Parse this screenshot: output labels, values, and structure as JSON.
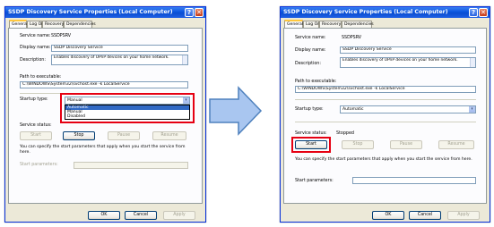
{
  "left": {
    "title": "SSDP Discovery Service Properties (Local Computer)",
    "help": "?",
    "close": "✕",
    "tabs": [
      "General",
      "Log On",
      "Recovery",
      "Dependencies"
    ],
    "service_name_label": "Service name:",
    "service_name_value": "SSDPSRV",
    "display_name_label": "Display name:",
    "display_name_value": "SSDP Discovery Service",
    "description_label": "Description:",
    "description_value": "Enables discovery of UPnP devices on your home network.",
    "path_label": "Path to executable:",
    "path_value": "C:\\WINDOWS\\System32\\svchost.exe -k LocalService",
    "startup_type_label": "Startup type:",
    "startup_type_value": "Manual",
    "startup_options": [
      "Automatic",
      "Manual",
      "Disabled"
    ],
    "startup_selected_index": 0,
    "service_status_label": "Service status:",
    "service_status_value": "",
    "buttons": {
      "start": "Start",
      "stop": "Stop",
      "pause": "Pause",
      "resume": "Resume"
    },
    "note": "You can specify the start parameters that apply when you start the service from here.",
    "start_params_label": "Start parameters:",
    "ok": "OK",
    "cancel": "Cancel",
    "apply": "Apply"
  },
  "right": {
    "title": "SSDP Discovery Service Properties (Local Computer)",
    "help": "?",
    "close": "✕",
    "tabs": [
      "General",
      "Log On",
      "Recovery",
      "Dependencies"
    ],
    "service_name_label": "Service name:",
    "service_name_value": "SSDPSRV",
    "display_name_label": "Display name:",
    "display_name_value": "SSDP Discovery Service",
    "description_label": "Description:",
    "description_value": "Enables discovery of UPnP devices on your home network.",
    "path_label": "Path to executable:",
    "path_value": "C:\\WINDOWS\\System32\\svchost.exe -k LocalService",
    "startup_type_label": "Startup type:",
    "startup_type_value": "Automatic",
    "service_status_label": "Service status:",
    "service_status_value": "Stopped",
    "buttons": {
      "start": "Start",
      "stop": "Stop",
      "pause": "Pause",
      "resume": "Resume"
    },
    "note": "You can specify the start parameters that apply when you start the service from here.",
    "start_params_label": "Start parameters:",
    "ok": "OK",
    "cancel": "Cancel",
    "apply": "Apply"
  },
  "colors": {
    "highlight_box": "#e60012",
    "arrow_fill": "#a9c6f0",
    "arrow_stroke": "#4f81bd"
  },
  "icons": {
    "arrow": "right-arrow-icon",
    "dropdown": "chevron-down-icon"
  }
}
